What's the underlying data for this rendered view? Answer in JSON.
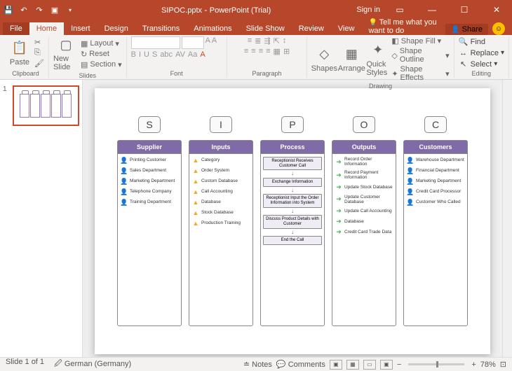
{
  "title": {
    "filename": "SIPOC.pptx",
    "app": "PowerPoint (Trial)",
    "signin": "Sign in"
  },
  "tabs": {
    "file": "File",
    "home": "Home",
    "insert": "Insert",
    "design": "Design",
    "transitions": "Transitions",
    "animations": "Animations",
    "slideshow": "Slide Show",
    "review": "Review",
    "view": "View",
    "tellme": "Tell me what you want to do",
    "share": "Share"
  },
  "ribbon": {
    "clipboard": "Clipboard",
    "paste": "Paste",
    "slides": "Slides",
    "newslide": "New Slide",
    "layout": "Layout",
    "reset": "Reset",
    "section": "Section",
    "font": "Font",
    "paragraph": "Paragraph",
    "drawing": "Drawing",
    "shapes": "Shapes",
    "arrange": "Arrange",
    "quickstyles": "Quick Styles",
    "shapefill": "Shape Fill",
    "shapeoutline": "Shape Outline",
    "shapeeffects": "Shape Effects",
    "editing": "Editing",
    "find": "Find",
    "replace": "Replace",
    "select": "Select"
  },
  "slide": {
    "letters": [
      "S",
      "I",
      "P",
      "O",
      "C"
    ],
    "columns": [
      {
        "hdr": "Supplier",
        "items": [
          {
            "ico": "p",
            "txt": "Printing Customer"
          },
          {
            "ico": "p",
            "txt": "Sales Department"
          },
          {
            "ico": "p",
            "txt": "Marketing Department"
          },
          {
            "ico": "p",
            "txt": "Telephone Company"
          },
          {
            "ico": "p",
            "txt": "Training Department"
          }
        ]
      },
      {
        "hdr": "Inputs",
        "items": [
          {
            "ico": "d",
            "txt": "Category"
          },
          {
            "ico": "d",
            "txt": "Order System"
          },
          {
            "ico": "d",
            "txt": "Custom Database"
          },
          {
            "ico": "d",
            "txt": "Call Accounting"
          },
          {
            "ico": "d",
            "txt": "Database"
          },
          {
            "ico": "d",
            "txt": "Stock Database"
          },
          {
            "ico": "d",
            "txt": "Production Training"
          }
        ]
      },
      {
        "hdr": "Process",
        "flow": [
          "Receptionist Receives Customer Call",
          "Exchange Information",
          "Receptionist Input the Order Information into System",
          "Discuss Product Details with Customer",
          "End the Call"
        ]
      },
      {
        "hdr": "Outputs",
        "items": [
          {
            "ico": "a",
            "txt": "Record Order Information"
          },
          {
            "ico": "a",
            "txt": "Record Payment Information"
          },
          {
            "ico": "a",
            "txt": "Update Stock Database"
          },
          {
            "ico": "a",
            "txt": "Update Customer Database"
          },
          {
            "ico": "a",
            "txt": "Update Call Accounting"
          },
          {
            "ico": "a",
            "txt": "Database"
          },
          {
            "ico": "a",
            "txt": "Credit Card Trade Data"
          }
        ]
      },
      {
        "hdr": "Customers",
        "items": [
          {
            "ico": "r",
            "txt": "Warehouse Department"
          },
          {
            "ico": "r",
            "txt": "Financial Department"
          },
          {
            "ico": "r",
            "txt": "Marketing Department"
          },
          {
            "ico": "r",
            "txt": "Credit Card Processor"
          },
          {
            "ico": "r",
            "txt": "Customer Who Called"
          }
        ]
      }
    ]
  },
  "status": {
    "slide": "Slide 1 of 1",
    "lang": "German (Germany)",
    "notes": "Notes",
    "comments": "Comments",
    "zoom": "78%"
  }
}
